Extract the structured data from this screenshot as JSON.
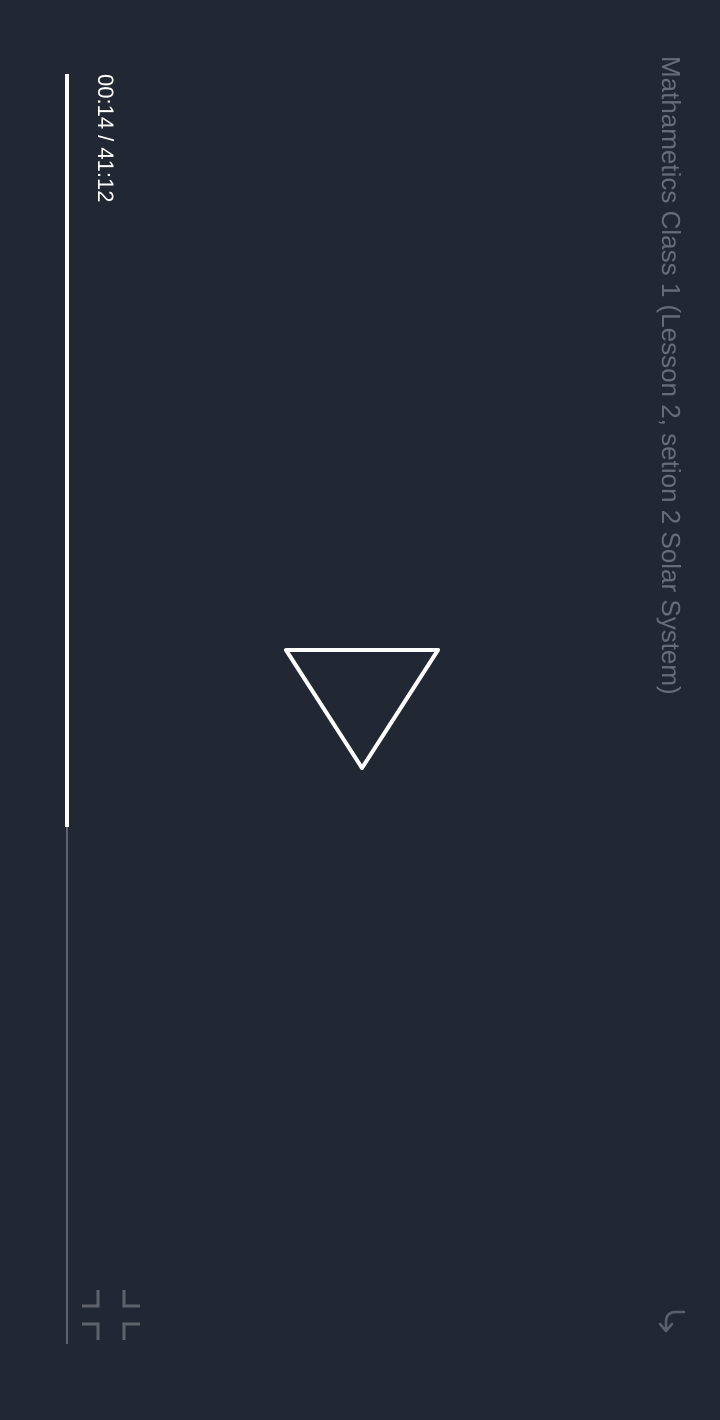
{
  "video": {
    "title": "Mathametics Class 1 (Lesson 2, setion 2  Solar System)",
    "current_time": "00:14",
    "duration": "41:12",
    "time_display": "00:14 / 41:12",
    "progress_fraction": 0.593
  },
  "icons": {
    "share": "share-icon",
    "play": "play-icon",
    "fullscreen": "exit-fullscreen-icon"
  },
  "colors": {
    "background": "#222833",
    "title_text": "#676d77",
    "time_text": "#ffffff",
    "progress_fill": "#ffffff",
    "progress_track": "#5d626b",
    "icon_stroke": "#ffffff"
  }
}
